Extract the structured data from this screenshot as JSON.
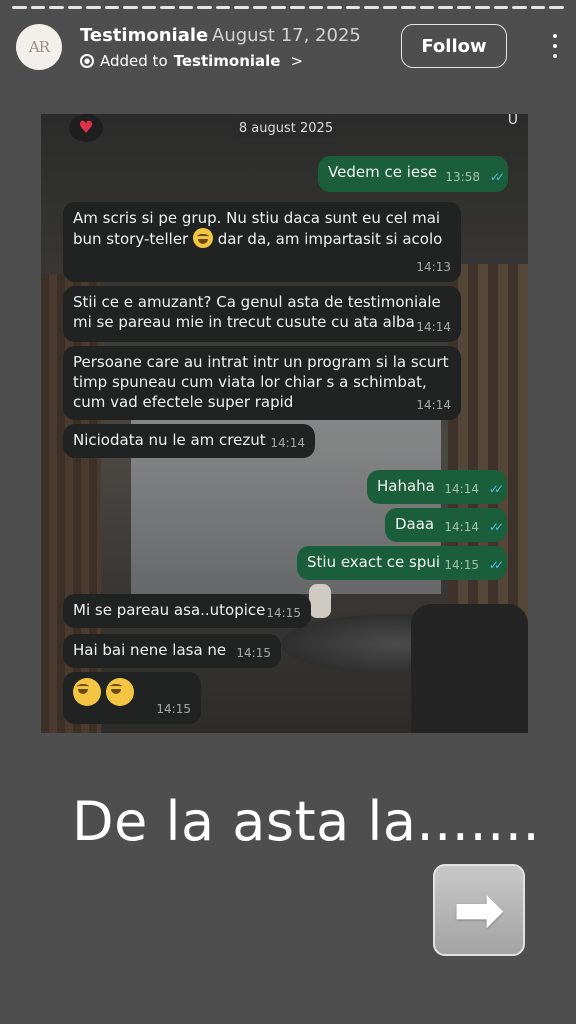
{
  "header": {
    "avatar_initials": "AR",
    "account_name": "Testimoniale",
    "date": "August 17, 2025",
    "added_to_prefix": "Added to",
    "added_to_name": "Testimoniale",
    "added_chevron": ">",
    "follow_label": "Follow"
  },
  "chat": {
    "date_pill": "8 august 2025",
    "corner_char": "U",
    "messages": [
      {
        "dir": "out",
        "text": "Vedem ce iese",
        "time": "13:58"
      },
      {
        "dir": "in",
        "text_a": "Am scris si pe grup. Nu stiu daca sunt eu cel mai bun story-teller",
        "text_b": "dar da, am impartasit si acolo",
        "time": "14:13"
      },
      {
        "dir": "in",
        "text": "Stii ce e amuzant? Ca genul asta de testimoniale mi se pareau mie in trecut cusute cu ata alba",
        "time": "14:14"
      },
      {
        "dir": "in",
        "text": "Persoane care au intrat intr un program si la scurt timp spuneau cum viata lor chiar s a schimbat, cum vad efectele super rapid",
        "time": "14:14"
      },
      {
        "dir": "in",
        "text": "Niciodata nu le am crezut",
        "time": "14:14"
      },
      {
        "dir": "out",
        "text": "Hahaha",
        "time": "14:14"
      },
      {
        "dir": "out",
        "text": "Daaa",
        "time": "14:14"
      },
      {
        "dir": "out",
        "text": "Stiu exact ce spui",
        "time": "14:15"
      },
      {
        "dir": "in",
        "text": "Mi se pareau asa..utopice",
        "time": "14:15"
      },
      {
        "dir": "in",
        "text": "Hai bai nene lasa ne",
        "time": "14:15"
      },
      {
        "dir": "in",
        "text": "",
        "time": "14:15"
      }
    ]
  },
  "caption": "De la asta la.......",
  "icons": {
    "heart": "heart-icon",
    "arrow": "right-arrow-icon",
    "emoji": "rolling-laughing-emoji"
  },
  "colors": {
    "outgoing_bubble": "#1b5e3b",
    "incoming_bubble": "#202322",
    "read_ticks": "#53bdeb",
    "background": "#4d4e4d"
  }
}
